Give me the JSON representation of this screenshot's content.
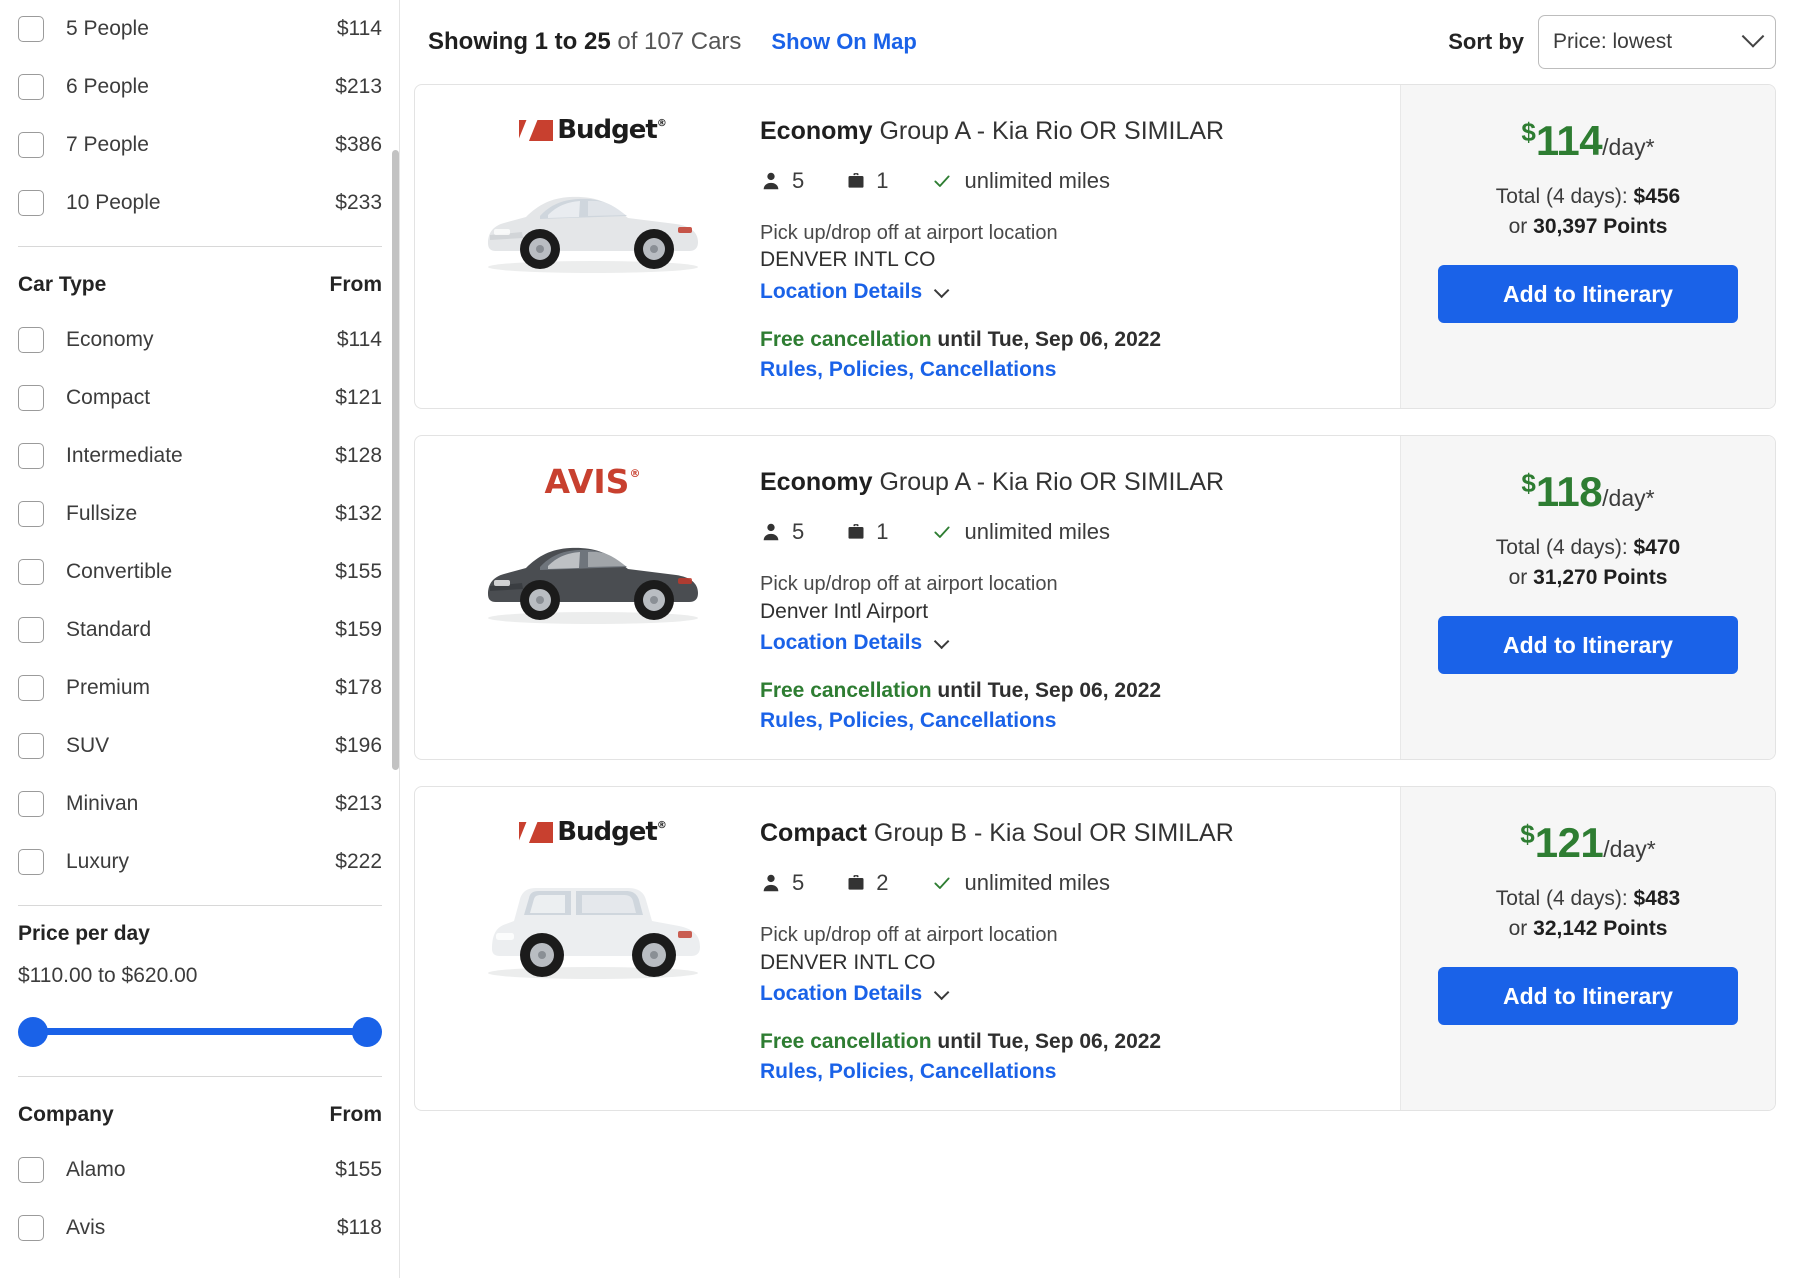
{
  "sidebar": {
    "people_filters": [
      {
        "label": "5 People",
        "price": "$114"
      },
      {
        "label": "6 People",
        "price": "$213"
      },
      {
        "label": "7 People",
        "price": "$386"
      },
      {
        "label": "10 People",
        "price": "$233"
      }
    ],
    "car_type": {
      "title": "Car Type",
      "from_label": "From",
      "items": [
        {
          "label": "Economy",
          "price": "$114"
        },
        {
          "label": "Compact",
          "price": "$121"
        },
        {
          "label": "Intermediate",
          "price": "$128"
        },
        {
          "label": "Fullsize",
          "price": "$132"
        },
        {
          "label": "Convertible",
          "price": "$155"
        },
        {
          "label": "Standard",
          "price": "$159"
        },
        {
          "label": "Premium",
          "price": "$178"
        },
        {
          "label": "SUV",
          "price": "$196"
        },
        {
          "label": "Minivan",
          "price": "$213"
        },
        {
          "label": "Luxury",
          "price": "$222"
        }
      ]
    },
    "price_per_day": {
      "title": "Price per day",
      "range_text": "$110.00 to $620.00",
      "min": "$110.00",
      "max": "$620.00"
    },
    "company": {
      "title": "Company",
      "from_label": "From",
      "items": [
        {
          "label": "Alamo",
          "price": "$155"
        },
        {
          "label": "Avis",
          "price": "$118"
        }
      ]
    }
  },
  "header": {
    "showing_prefix": "Showing 1 to 25",
    "showing_suffix": " of 107 Cars",
    "show_on_map": "Show On Map",
    "sort_label": "Sort by",
    "sort_value": "Price: lowest"
  },
  "colors": {
    "accent_blue": "#1a62e8",
    "price_green": "#2e7d32",
    "vendor_red": "#c8402f",
    "panel_gray": "#f6f6f6"
  },
  "cards": [
    {
      "vendor": "Budget",
      "vendor_mark": "budget-logo",
      "car_color": "white",
      "car_body": "sedan",
      "class_name": "Economy",
      "class_desc": " Group A - Kia Rio OR SIMILAR",
      "passengers": "5",
      "bags": "1",
      "mileage": "unlimited miles",
      "pickup_note": "Pick up/drop off at airport location",
      "location": "DENVER INTL CO",
      "location_details": "Location Details",
      "cancel_free": "Free cancellation",
      "cancel_rest": " until Tue, Sep 06, 2022",
      "rules_link": "Rules, Policies, Cancellations",
      "price_currency": "$",
      "price_amount": "114",
      "price_per": "/day*",
      "total_label": "Total (4 days): ",
      "total_value": "$456",
      "points_prefix": "or ",
      "points_value": "30,397 Points",
      "add_button": "Add to Itinerary"
    },
    {
      "vendor": "AVIS",
      "vendor_mark": "avis-logo",
      "car_color": "dark",
      "car_body": "sedan",
      "class_name": "Economy",
      "class_desc": " Group A - Kia Rio OR SIMILAR",
      "passengers": "5",
      "bags": "1",
      "mileage": "unlimited miles",
      "pickup_note": "Pick up/drop off at airport location",
      "location": "Denver Intl Airport",
      "location_details": "Location Details",
      "cancel_free": "Free cancellation",
      "cancel_rest": " until Tue, Sep 06, 2022",
      "rules_link": "Rules, Policies, Cancellations",
      "price_currency": "$",
      "price_amount": "118",
      "price_per": "/day*",
      "total_label": "Total (4 days): ",
      "total_value": "$470",
      "points_prefix": "or ",
      "points_value": "31,270 Points",
      "add_button": "Add to Itinerary"
    },
    {
      "vendor": "Budget",
      "vendor_mark": "budget-logo",
      "car_color": "white",
      "car_body": "suv",
      "class_name": "Compact",
      "class_desc": " Group B - Kia Soul OR SIMILAR",
      "passengers": "5",
      "bags": "2",
      "mileage": "unlimited miles",
      "pickup_note": "Pick up/drop off at airport location",
      "location": "DENVER INTL CO",
      "location_details": "Location Details",
      "cancel_free": "Free cancellation",
      "cancel_rest": " until Tue, Sep 06, 2022",
      "rules_link": "Rules, Policies, Cancellations",
      "price_currency": "$",
      "price_amount": "121",
      "price_per": "/day*",
      "total_label": "Total (4 days): ",
      "total_value": "$483",
      "points_prefix": "or ",
      "points_value": "32,142 Points",
      "add_button": "Add to Itinerary"
    }
  ]
}
